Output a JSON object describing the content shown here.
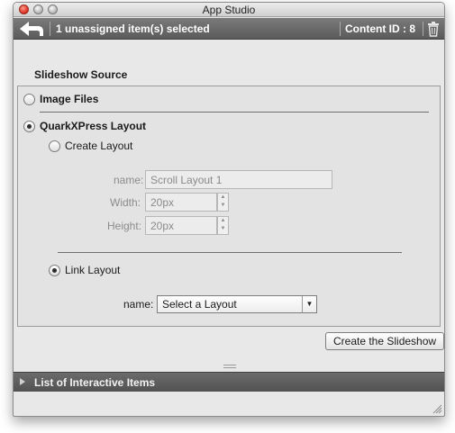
{
  "window": {
    "title": "App Studio"
  },
  "toolbar": {
    "selection_text": "1 unassigned item(s) selected",
    "content_id_text": "Content ID : 8"
  },
  "source": {
    "heading": "Slideshow Source",
    "image_files_label": "Image Files",
    "quarkxpress_layout_label": "QuarkXPress Layout",
    "selected_option": "QuarkXPress Layout",
    "create_layout_label": "Create Layout",
    "link_layout_label": "Link Layout",
    "link_selected": true,
    "create": {
      "name_label": "name:",
      "name_value": "Scroll Layout 1",
      "width_label": "Width:",
      "width_value": "20px",
      "height_label": "Height:",
      "height_value": "20px"
    },
    "link": {
      "name_label": "name:",
      "select_value": "Select a Layout"
    }
  },
  "actions": {
    "create_button": "Create the Slideshow"
  },
  "bottom": {
    "list_label": "List of Interactive Items"
  },
  "colors": {
    "toolbar_bg": "#5b5b5b",
    "panel_bg": "#e3e3e3",
    "window_bg": "#e8e8e8"
  }
}
